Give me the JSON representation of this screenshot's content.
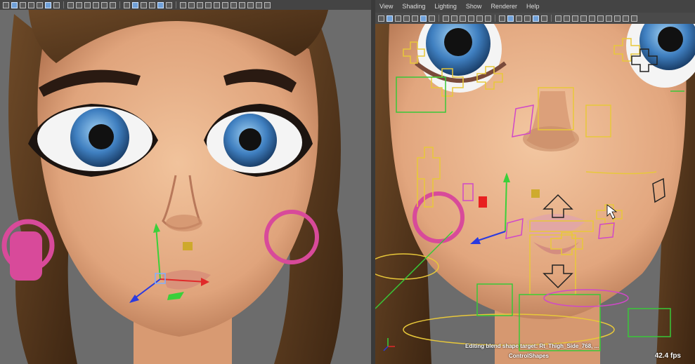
{
  "menu": {
    "items": [
      "View",
      "Shading",
      "Lighting",
      "Show",
      "Renderer",
      "Help"
    ]
  },
  "hud": {
    "status": "Editing blend shape target: Rt_Thigh_Side_768, ...",
    "layer": "ControlShapes",
    "fps": "42.4 fps"
  },
  "colors": {
    "viewport_bg": "#6c6c6c",
    "skin": "#e8b08a",
    "hair": "#5c3a1e",
    "iris": "#3f7fc0",
    "earring": "#d84a9a",
    "control_yellow": "#e8c83a",
    "control_green": "#38c838",
    "control_magenta": "#d048c8"
  }
}
